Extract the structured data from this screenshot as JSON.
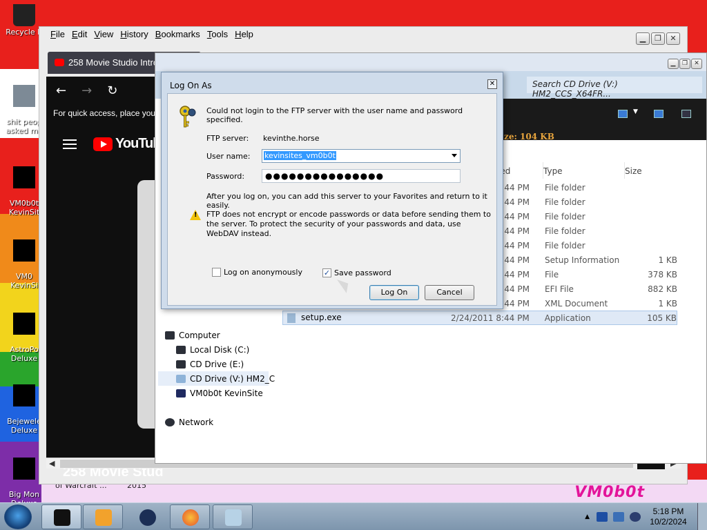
{
  "desktop": {
    "icons": [
      {
        "label": "Recycle B"
      },
      {
        "label": "shit peop\nasked me"
      },
      {
        "label": "VM0b0t\nKevinSit"
      },
      {
        "label": "VM0\nKevinSi"
      },
      {
        "label": "AstroPo\nDeluxe"
      },
      {
        "label": "Bejewele\nDeluxe"
      },
      {
        "label": "Big Mon\nDeluxe"
      }
    ],
    "bottom_captions": [
      "of Warcraft ...",
      "2015"
    ],
    "watermark": "VM0b0t",
    "stripe_colors": [
      "#ffffff",
      "#e8201c",
      "#f08a1a",
      "#f2d41c",
      "#2aa52c",
      "#1f63e0",
      "#7d2da8"
    ]
  },
  "firefox": {
    "menu": [
      "File",
      "Edit",
      "View",
      "History",
      "Bookmarks",
      "Tools",
      "Help"
    ],
    "tab_title": "258 Movie Studio Intros",
    "bookmark_hint": "For quick access, place your",
    "youtube_logo": "YouTube",
    "video_title": "258 Movie Stud"
  },
  "explorer": {
    "search_placeholder": "Search CD Drive (V:) HM2_CCS_X64FR...",
    "size_info": "ze: 104 KB",
    "columns": {
      "date": "ied",
      "type": "Type",
      "size": "Size"
    },
    "rows": [
      {
        "name": "",
        "date": "44 PM",
        "type": "File folder",
        "size": ""
      },
      {
        "name": "",
        "date": "44 PM",
        "type": "File folder",
        "size": ""
      },
      {
        "name": "",
        "date": "44 PM",
        "type": "File folder",
        "size": ""
      },
      {
        "name": "",
        "date": "44 PM",
        "type": "File folder",
        "size": ""
      },
      {
        "name": "",
        "date": "44 PM",
        "type": "File folder",
        "size": ""
      },
      {
        "name": "",
        "date": "44 PM",
        "type": "Setup Information",
        "size": "1 KB"
      },
      {
        "name": "",
        "date": "44 PM",
        "type": "File",
        "size": "378 KB"
      },
      {
        "name": "",
        "date": "44 PM",
        "type": "EFI File",
        "size": "882 KB"
      },
      {
        "name": "",
        "date": "44 PM",
        "type": "XML Document",
        "size": "1 KB"
      },
      {
        "name": "setup.exe",
        "date": "2/24/2011 8:44 PM",
        "type": "Application",
        "size": "105 KB"
      }
    ],
    "tree": [
      {
        "label": "Computer"
      },
      {
        "label": "Local Disk (C:)"
      },
      {
        "label": "CD Drive (E:)"
      },
      {
        "label": "CD Drive (V:) HM2_C"
      },
      {
        "label": "VM0b0t KevinSite"
      },
      {
        "label": "Network"
      }
    ]
  },
  "dialog": {
    "title": "Log On As",
    "message": "Could not login to the FTP server with the user name and password specified.",
    "ftp_server_label": "FTP server:",
    "ftp_server_value": "kevinthe.horse",
    "user_label": "User name:",
    "user_value": "kevinsites_vm0b0t",
    "password_label": "Password:",
    "password_value": "●●●●●●●●●●●●●●●",
    "info": "After you log on, you can add this server to your Favorites and return to it easily.",
    "warning": "FTP does not encrypt or encode passwords or data before sending them to the server.  To protect the security of your passwords and data, use WebDAV instead.",
    "anon_label": "Log on anonymously",
    "anon_checked": false,
    "save_label": "Save password",
    "save_checked": true,
    "logon_button": "Log On",
    "cancel_button": "Cancel"
  },
  "taskbar": {
    "time": "5:18 PM",
    "date": "10/2/2024"
  }
}
